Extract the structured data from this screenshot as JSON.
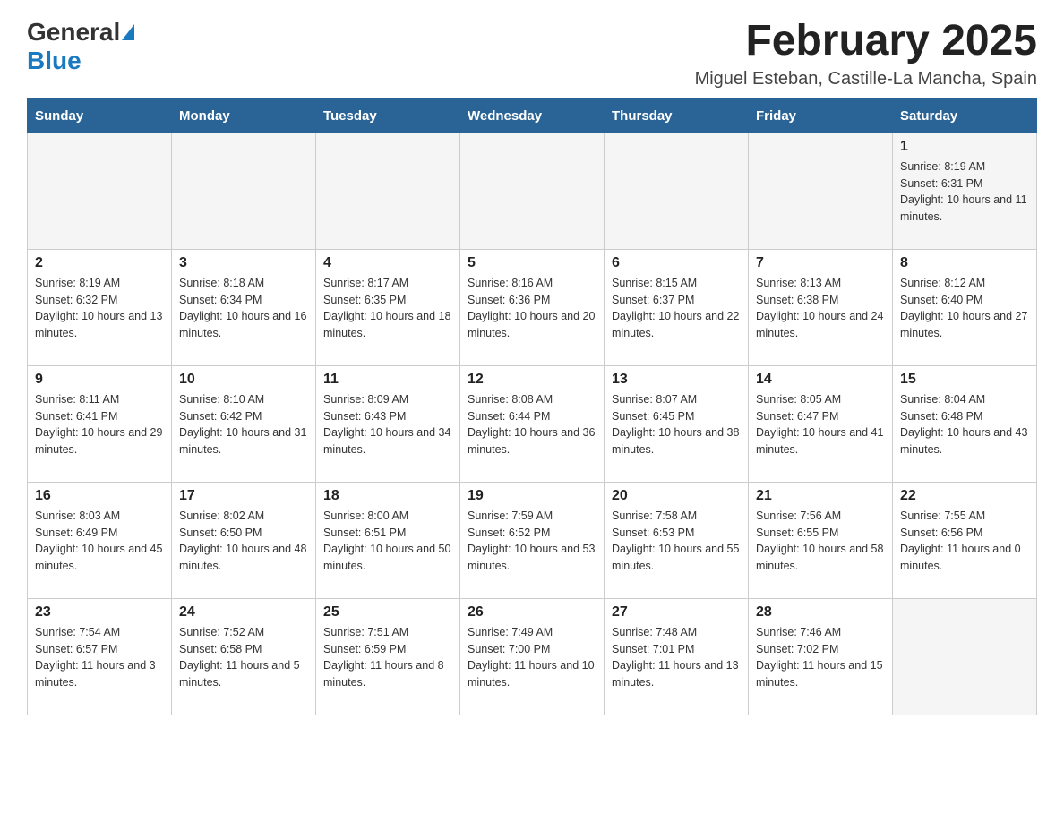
{
  "logo": {
    "general": "General",
    "blue": "Blue"
  },
  "title": "February 2025",
  "location": "Miguel Esteban, Castille-La Mancha, Spain",
  "weekdays": [
    "Sunday",
    "Monday",
    "Tuesday",
    "Wednesday",
    "Thursday",
    "Friday",
    "Saturday"
  ],
  "weeks": [
    [
      {
        "day": "",
        "info": ""
      },
      {
        "day": "",
        "info": ""
      },
      {
        "day": "",
        "info": ""
      },
      {
        "day": "",
        "info": ""
      },
      {
        "day": "",
        "info": ""
      },
      {
        "day": "",
        "info": ""
      },
      {
        "day": "1",
        "info": "Sunrise: 8:19 AM\nSunset: 6:31 PM\nDaylight: 10 hours and 11 minutes."
      }
    ],
    [
      {
        "day": "2",
        "info": "Sunrise: 8:19 AM\nSunset: 6:32 PM\nDaylight: 10 hours and 13 minutes."
      },
      {
        "day": "3",
        "info": "Sunrise: 8:18 AM\nSunset: 6:34 PM\nDaylight: 10 hours and 16 minutes."
      },
      {
        "day": "4",
        "info": "Sunrise: 8:17 AM\nSunset: 6:35 PM\nDaylight: 10 hours and 18 minutes."
      },
      {
        "day": "5",
        "info": "Sunrise: 8:16 AM\nSunset: 6:36 PM\nDaylight: 10 hours and 20 minutes."
      },
      {
        "day": "6",
        "info": "Sunrise: 8:15 AM\nSunset: 6:37 PM\nDaylight: 10 hours and 22 minutes."
      },
      {
        "day": "7",
        "info": "Sunrise: 8:13 AM\nSunset: 6:38 PM\nDaylight: 10 hours and 24 minutes."
      },
      {
        "day": "8",
        "info": "Sunrise: 8:12 AM\nSunset: 6:40 PM\nDaylight: 10 hours and 27 minutes."
      }
    ],
    [
      {
        "day": "9",
        "info": "Sunrise: 8:11 AM\nSunset: 6:41 PM\nDaylight: 10 hours and 29 minutes."
      },
      {
        "day": "10",
        "info": "Sunrise: 8:10 AM\nSunset: 6:42 PM\nDaylight: 10 hours and 31 minutes."
      },
      {
        "day": "11",
        "info": "Sunrise: 8:09 AM\nSunset: 6:43 PM\nDaylight: 10 hours and 34 minutes."
      },
      {
        "day": "12",
        "info": "Sunrise: 8:08 AM\nSunset: 6:44 PM\nDaylight: 10 hours and 36 minutes."
      },
      {
        "day": "13",
        "info": "Sunrise: 8:07 AM\nSunset: 6:45 PM\nDaylight: 10 hours and 38 minutes."
      },
      {
        "day": "14",
        "info": "Sunrise: 8:05 AM\nSunset: 6:47 PM\nDaylight: 10 hours and 41 minutes."
      },
      {
        "day": "15",
        "info": "Sunrise: 8:04 AM\nSunset: 6:48 PM\nDaylight: 10 hours and 43 minutes."
      }
    ],
    [
      {
        "day": "16",
        "info": "Sunrise: 8:03 AM\nSunset: 6:49 PM\nDaylight: 10 hours and 45 minutes."
      },
      {
        "day": "17",
        "info": "Sunrise: 8:02 AM\nSunset: 6:50 PM\nDaylight: 10 hours and 48 minutes."
      },
      {
        "day": "18",
        "info": "Sunrise: 8:00 AM\nSunset: 6:51 PM\nDaylight: 10 hours and 50 minutes."
      },
      {
        "day": "19",
        "info": "Sunrise: 7:59 AM\nSunset: 6:52 PM\nDaylight: 10 hours and 53 minutes."
      },
      {
        "day": "20",
        "info": "Sunrise: 7:58 AM\nSunset: 6:53 PM\nDaylight: 10 hours and 55 minutes."
      },
      {
        "day": "21",
        "info": "Sunrise: 7:56 AM\nSunset: 6:55 PM\nDaylight: 10 hours and 58 minutes."
      },
      {
        "day": "22",
        "info": "Sunrise: 7:55 AM\nSunset: 6:56 PM\nDaylight: 11 hours and 0 minutes."
      }
    ],
    [
      {
        "day": "23",
        "info": "Sunrise: 7:54 AM\nSunset: 6:57 PM\nDaylight: 11 hours and 3 minutes."
      },
      {
        "day": "24",
        "info": "Sunrise: 7:52 AM\nSunset: 6:58 PM\nDaylight: 11 hours and 5 minutes."
      },
      {
        "day": "25",
        "info": "Sunrise: 7:51 AM\nSunset: 6:59 PM\nDaylight: 11 hours and 8 minutes."
      },
      {
        "day": "26",
        "info": "Sunrise: 7:49 AM\nSunset: 7:00 PM\nDaylight: 11 hours and 10 minutes."
      },
      {
        "day": "27",
        "info": "Sunrise: 7:48 AM\nSunset: 7:01 PM\nDaylight: 11 hours and 13 minutes."
      },
      {
        "day": "28",
        "info": "Sunrise: 7:46 AM\nSunset: 7:02 PM\nDaylight: 11 hours and 15 minutes."
      },
      {
        "day": "",
        "info": ""
      }
    ]
  ]
}
